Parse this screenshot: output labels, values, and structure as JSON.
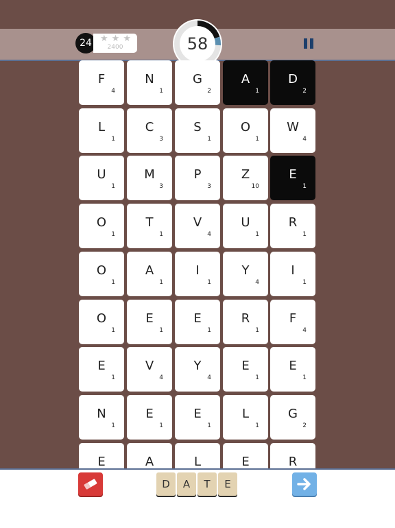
{
  "header": {
    "level": "24",
    "stars_filled": 0,
    "stars_total": 3,
    "target_score": "2400",
    "timer_value": "58",
    "timer_progress": 0.2
  },
  "board": {
    "rows": [
      [
        {
          "l": "F",
          "p": "4"
        },
        {
          "l": "N",
          "p": "1"
        },
        {
          "l": "G",
          "p": "2"
        },
        {
          "l": "A",
          "p": "1",
          "sel": true
        },
        {
          "l": "D",
          "p": "2",
          "sel": true
        }
      ],
      [
        {
          "l": "L",
          "p": "1"
        },
        {
          "l": "C",
          "p": "3"
        },
        {
          "l": "S",
          "p": "1"
        },
        {
          "l": "O",
          "p": "1"
        },
        {
          "l": "W",
          "p": "4"
        }
      ],
      [
        {
          "l": "U",
          "p": "1"
        },
        {
          "l": "M",
          "p": "3"
        },
        {
          "l": "P",
          "p": "3"
        },
        {
          "l": "Z",
          "p": "10"
        },
        {
          "l": "E",
          "p": "1",
          "sel": true
        }
      ],
      [
        {
          "l": "O",
          "p": "1"
        },
        {
          "l": "T",
          "p": "1"
        },
        {
          "l": "V",
          "p": "4"
        },
        {
          "l": "U",
          "p": "1"
        },
        {
          "l": "R",
          "p": "1"
        }
      ],
      [
        {
          "l": "O",
          "p": "1"
        },
        {
          "l": "A",
          "p": "1"
        },
        {
          "l": "I",
          "p": "1"
        },
        {
          "l": "Y",
          "p": "4"
        },
        {
          "l": "I",
          "p": "1"
        }
      ],
      [
        {
          "l": "O",
          "p": "1"
        },
        {
          "l": "E",
          "p": "1"
        },
        {
          "l": "E",
          "p": "1"
        },
        {
          "l": "R",
          "p": "1"
        },
        {
          "l": "F",
          "p": "4"
        }
      ],
      [
        {
          "l": "E",
          "p": "1"
        },
        {
          "l": "V",
          "p": "4"
        },
        {
          "l": "Y",
          "p": "4"
        },
        {
          "l": "E",
          "p": "1"
        },
        {
          "l": "E",
          "p": "1"
        }
      ],
      [
        {
          "l": "N",
          "p": "1"
        },
        {
          "l": "E",
          "p": "1"
        },
        {
          "l": "E",
          "p": "1"
        },
        {
          "l": "L",
          "p": "1"
        },
        {
          "l": "G",
          "p": "2"
        }
      ],
      [
        {
          "l": "E",
          "p": ""
        },
        {
          "l": "A",
          "p": ""
        },
        {
          "l": "L",
          "p": ""
        },
        {
          "l": "E",
          "p": ""
        },
        {
          "l": "R",
          "p": ""
        }
      ]
    ]
  },
  "footer": {
    "current_word": [
      "D",
      "A",
      "T",
      "E"
    ],
    "eraser_icon": "eraser-icon",
    "submit_icon": "arrow-right-icon"
  },
  "colors": {
    "background": "#6b4d47",
    "header_bar": "#a8918d",
    "selected_tile": "#0b0b0b",
    "eraser_button": "#d83a38",
    "submit_button": "#72b1e6",
    "word_tile": "#e3d3b2"
  }
}
